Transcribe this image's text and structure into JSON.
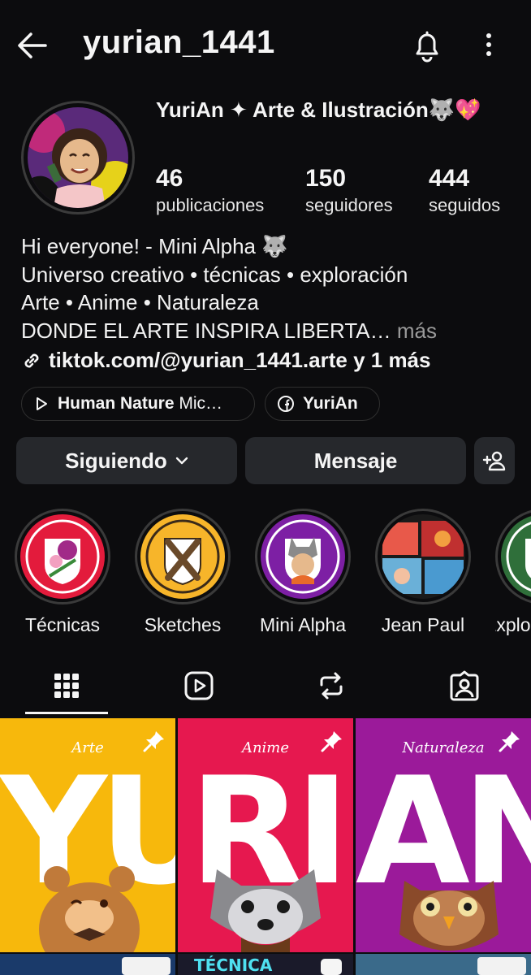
{
  "header": {
    "username": "yurian_1441"
  },
  "profile": {
    "display_name": "YuriAn ✦ Arte & Ilustración🐺💖",
    "stats": [
      {
        "value": "46",
        "label": "publicaciones"
      },
      {
        "value": "150",
        "label": "seguidores"
      },
      {
        "value": "444",
        "label": "seguidos"
      }
    ],
    "bio": [
      "Hi everyone! - Mini Alpha 🐺",
      "Universo creativo • técnicas • exploración",
      "Arte • Anime • Naturaleza",
      "DONDE EL ARTE INSPIRA LIBERTA…"
    ],
    "bio_more": " más",
    "link": "tiktok.com/@yurian_1441.arte y 1 más"
  },
  "chips": {
    "music_bold": "Human Nature",
    "music_rest": " Mic…",
    "facebook": "YuriAn"
  },
  "actions": {
    "following": "Siguiendo",
    "message": "Mensaje"
  },
  "highlights": [
    {
      "label": "Técnicas",
      "color": "#e31b3c"
    },
    {
      "label": "Sketches",
      "color": "#f7b52a"
    },
    {
      "label": "Mini Alpha",
      "color": "#7d1fa4"
    },
    {
      "label": "Jean Paul",
      "color": "#e8594a"
    },
    {
      "label": "Explo",
      "color": "#2f6f3a"
    }
  ],
  "posts": [
    {
      "category": "Arte",
      "big": "YU",
      "color": "#f7b80c"
    },
    {
      "category": "Anime",
      "big": "RI",
      "color": "#e6184f"
    },
    {
      "category": "Naturaleza",
      "big": "AN",
      "color": "#9b1a9a"
    }
  ],
  "row2": {
    "tecnica": "TÉCNICA"
  }
}
